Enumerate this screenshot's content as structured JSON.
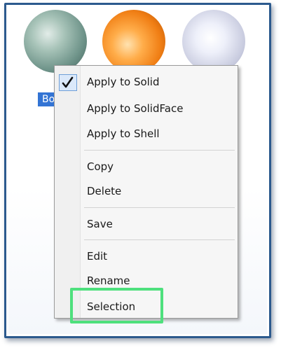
{
  "material_tiles": [
    {
      "name": "green-sphere",
      "color": "#8fb0a6"
    },
    {
      "name": "orange-sphere",
      "color": "#f5922a"
    },
    {
      "name": "silver-sphere",
      "color": "#dfe1ef"
    }
  ],
  "selected_tile_label": "Bo",
  "context_menu": {
    "items": [
      {
        "label": "Apply to Solid",
        "checked": true
      },
      {
        "label": "Apply to SolidFace"
      },
      {
        "label": "Apply to Shell"
      },
      {
        "label": "Copy"
      },
      {
        "label": "Delete"
      },
      {
        "label": "Save"
      },
      {
        "label": "Edit"
      },
      {
        "label": "Rename"
      },
      {
        "label": "Selection"
      }
    ],
    "check_icon": "checkmark-icon"
  },
  "highlight": {
    "target": "Selection",
    "color": "#4ee07d"
  },
  "colors": {
    "frame_border": "#2c5a8e",
    "selection_blue": "#3374d4",
    "menu_background": "#f6f6f6"
  }
}
